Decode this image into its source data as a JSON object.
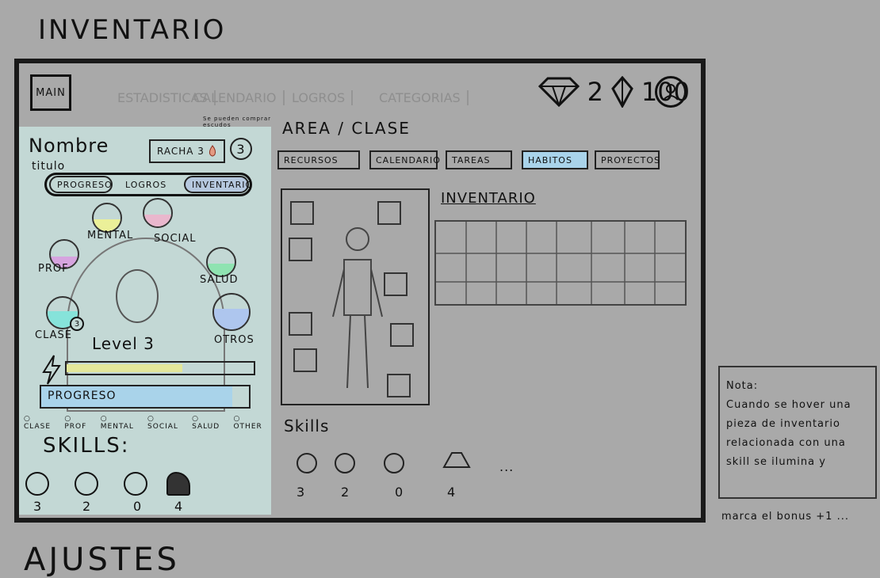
{
  "page_title": "INVENTARIO",
  "bottom_title": "AJUSTES",
  "header": {
    "main_button": "MAIN",
    "faint_tabs": [
      "ESTADISTICAS",
      "CALENDARIO",
      "LOGROS",
      "CATEGORIAS"
    ],
    "gems": "2",
    "crystals": "100"
  },
  "profile": {
    "name": "Nombre",
    "title": "titulo",
    "streak_label": "RACHA 3",
    "streak_count": "3",
    "streak_note": "Se pueden comprar escudos",
    "pills": [
      "PROGRESO",
      "LOGROS",
      "INVENTARIO"
    ],
    "stats": [
      "MENTAL",
      "SOCIAL",
      "PROF",
      "SALUD",
      "CLASE",
      "OTROS"
    ],
    "class_badge": "3",
    "level": "Level 3",
    "progress_label": "PROGRESO",
    "legend": [
      "CLASE",
      "PROF",
      "MENTAL",
      "SOCIAL",
      "SALUD",
      "OTHER"
    ],
    "skills_title": "SKILLS:",
    "skill_values": [
      "3",
      "2",
      "0",
      "4"
    ]
  },
  "main": {
    "breadcrumb": "AREA / CLASE",
    "tabs": [
      "RECURSOS",
      "CALENDARIO",
      "TAREAS",
      "HABITOS",
      "PROYECTOS"
    ],
    "active_tab": "HABITOS",
    "inventory_title": "INVENTARIO",
    "skills_title": "Skills",
    "skill_values": [
      "3",
      "2",
      "0",
      "4"
    ],
    "more": "..."
  },
  "note": {
    "heading": "Nota:",
    "body": "Cuando se hover una pieza de inventario relacionada con una skill se ilumina y",
    "tail": "marca el bonus +1 ..."
  },
  "colors": {
    "background": "#a9a9a9",
    "left_panel": "#c3d8d5",
    "tab_active": "#a9d3ea",
    "energy": "#e3e79a",
    "progress": "#a9d3ea"
  }
}
